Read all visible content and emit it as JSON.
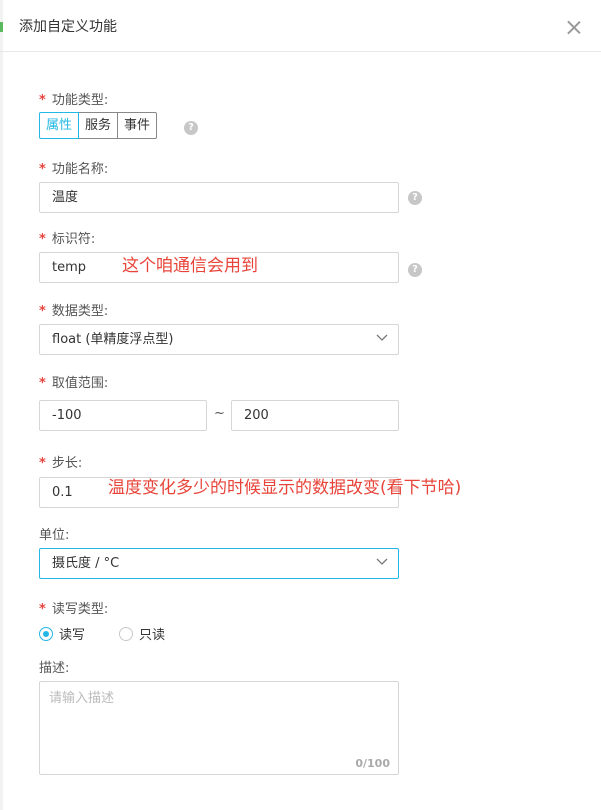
{
  "dialog": {
    "title": "添加自定义功能"
  },
  "form": {
    "function_type": {
      "label": "功能类型:",
      "options": [
        "属性",
        "服务",
        "事件"
      ],
      "selected": "属性"
    },
    "function_name": {
      "label": "功能名称:",
      "value": "温度"
    },
    "identifier": {
      "label": "标识符:",
      "value": "temp"
    },
    "data_type": {
      "label": "数据类型:",
      "value": "float (单精度浮点型)"
    },
    "value_range": {
      "label": "取值范围:",
      "min": "-100",
      "separator": "~",
      "max": "200"
    },
    "step": {
      "label": "步长:",
      "value": "0.1"
    },
    "unit": {
      "label": "单位:",
      "value": "摄氏度 / °C"
    },
    "rw_type": {
      "label": "读写类型:",
      "options": [
        "读写",
        "只读"
      ],
      "selected": "读写"
    },
    "description": {
      "label": "描述:",
      "placeholder": "请输入描述",
      "counter": "0/100"
    }
  },
  "annotations": {
    "identifier_note": "这个咱通信会用到",
    "step_note": "温度变化多少的时候显示的数据改变(看下节哈)"
  },
  "colors": {
    "accent": "#23b7e5",
    "required": "#e64340",
    "annotation": "#e8443a"
  },
  "help_icon_glyph": "?",
  "required_mark": "*"
}
